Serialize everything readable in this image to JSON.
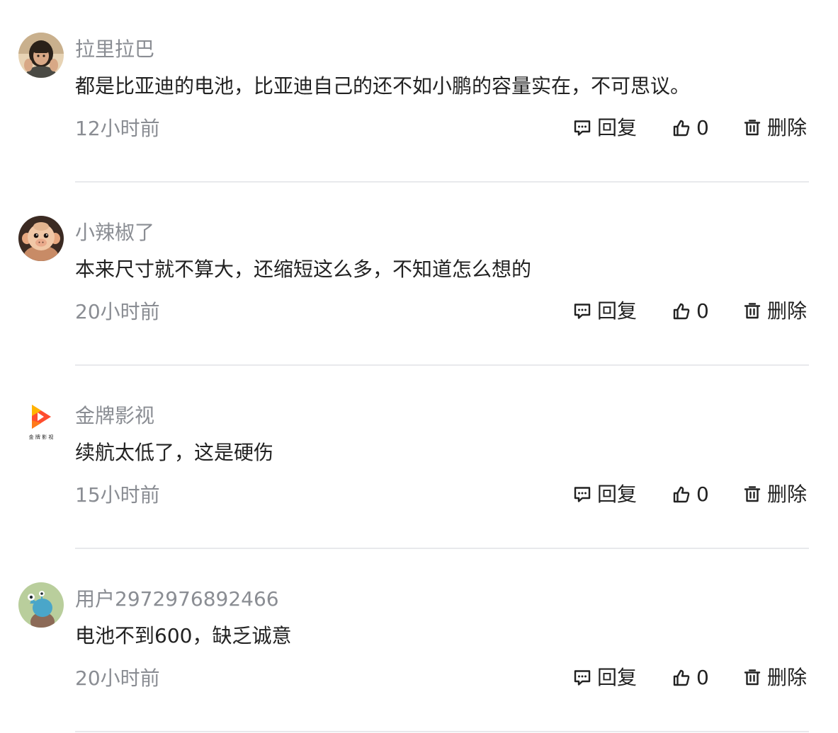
{
  "comments": [
    {
      "avatar": "portrait-photo",
      "username": "拉里拉巴",
      "content": "都是比亚迪的电池，比亚迪自己的还不如小鹏的容量实在，不可思议。",
      "time": "12小时前",
      "like_count": "0"
    },
    {
      "avatar": "cartoon-monkey",
      "username": "小辣椒了",
      "content": "本来尺寸就不算大，还缩短这么多，不知道怎么想的",
      "time": "20小时前",
      "like_count": "0"
    },
    {
      "avatar": "play-logo",
      "avatar_text": "金 牌 影 视",
      "username": "金牌影视",
      "content": "续航太低了，这是硬伤",
      "time": "15小时前",
      "like_count": "0"
    },
    {
      "avatar": "cartoon-bird",
      "username": "用户2972976892466",
      "content": "电池不到600，缺乏诚意",
      "time": "20小时前",
      "like_count": "0"
    }
  ],
  "actions": {
    "reply_label": "回复",
    "delete_label": "删除",
    "reply_icon": "comment-icon",
    "like_icon": "thumbs-up-icon",
    "delete_icon": "trash-icon"
  },
  "colors": {
    "text": "#222222",
    "muted": "#8a8d93",
    "divider": "#e8e9ec",
    "logo_orange": "#ff4d2e",
    "logo_yellow": "#ffb400"
  }
}
